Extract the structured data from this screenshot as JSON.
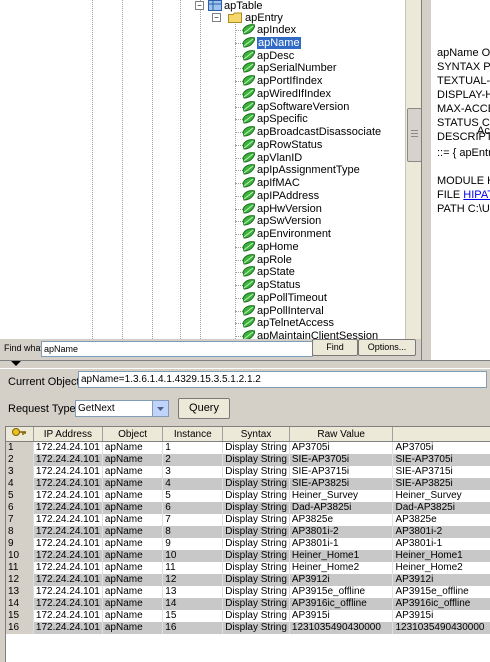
{
  "tree": {
    "table_label": "apTable",
    "entry_label": "apEntry",
    "items": [
      "apIndex",
      "apName",
      "apDesc",
      "apSerialNumber",
      "apPortIfIndex",
      "apWiredIfIndex",
      "apSoftwareVersion",
      "apSpecific",
      "apBroadcastDisassociate",
      "apRowStatus",
      "apVlanID",
      "apIpAssignmentType",
      "apIfMAC",
      "apIPAddress",
      "apHwVersion",
      "apSwVersion",
      "apEnvironment",
      "apHome",
      "apRole",
      "apState",
      "apStatus",
      "apPollTimeout",
      "apPollInterval",
      "apTelnetAccess",
      "apMaintainClientSession"
    ],
    "selected": "apName"
  },
  "right_pane": {
    "lines": [
      "apName OB",
      "SYNTAX Pri",
      "TEXTUAL-C",
      "DISPLAY-H",
      "MAX-ACCES",
      "STATUS Cu",
      "DESCRIPT",
      "",
      "Ac",
      "",
      "::= { apEntry",
      "",
      "MODULE H",
      "FILE HIPAT",
      "PATH C:\\Us"
    ],
    "link_text": "HIPAT"
  },
  "find": {
    "label": "Find what:",
    "value": "apName",
    "find_button": "Find",
    "options_button": "Options..."
  },
  "form": {
    "current_object_label": "Current Object:",
    "current_object_value": "apName=1.3.6.1.4.1.4329.15.3.5.1.2.1.2",
    "request_type_label": "Request Type:",
    "request_type_value": "GetNext",
    "query_button": "Query"
  },
  "table": {
    "columns": [
      "",
      "IP Address",
      "Object",
      "Instance",
      "Syntax",
      "Raw Value",
      ""
    ],
    "rows": [
      [
        "1",
        "172.24.24.101",
        "apName",
        "1",
        "Display String",
        "AP3705i",
        "AP3705i"
      ],
      [
        "2",
        "172.24.24.101",
        "apName",
        "2",
        "Display String",
        "SIE-AP3705i",
        "SIE-AP3705i"
      ],
      [
        "3",
        "172.24.24.101",
        "apName",
        "3",
        "Display String",
        "SIE-AP3715i",
        "SIE-AP3715i"
      ],
      [
        "4",
        "172.24.24.101",
        "apName",
        "4",
        "Display String",
        "SIE-AP3825i",
        "SIE-AP3825i"
      ],
      [
        "5",
        "172.24.24.101",
        "apName",
        "5",
        "Display String",
        "Heiner_Survey",
        "Heiner_Survey"
      ],
      [
        "6",
        "172.24.24.101",
        "apName",
        "6",
        "Display String",
        "Dad-AP3825i",
        "Dad-AP3825i"
      ],
      [
        "7",
        "172.24.24.101",
        "apName",
        "7",
        "Display String",
        "AP3825e",
        "AP3825e"
      ],
      [
        "8",
        "172.24.24.101",
        "apName",
        "8",
        "Display String",
        "AP3801i-2",
        "AP3801i-2"
      ],
      [
        "9",
        "172.24.24.101",
        "apName",
        "9",
        "Display String",
        "AP3801i-1",
        "AP3801i-1"
      ],
      [
        "10",
        "172.24.24.101",
        "apName",
        "10",
        "Display String",
        "Heiner_Home1",
        "Heiner_Home1"
      ],
      [
        "11",
        "172.24.24.101",
        "apName",
        "11",
        "Display String",
        "Heiner_Home2",
        "Heiner_Home2"
      ],
      [
        "12",
        "172.24.24.101",
        "apName",
        "12",
        "Display String",
        "AP3912i",
        "AP3912i"
      ],
      [
        "13",
        "172.24.24.101",
        "apName",
        "13",
        "Display String",
        "AP3915e_offline",
        "AP3915e_offline"
      ],
      [
        "14",
        "172.24.24.101",
        "apName",
        "14",
        "Display String",
        "AP3916ic_offline",
        "AP3916ic_offline"
      ],
      [
        "15",
        "172.24.24.101",
        "apName",
        "15",
        "Display String",
        "AP3915i",
        "AP3915i"
      ],
      [
        "16",
        "172.24.24.101",
        "apName",
        "16",
        "Display String",
        "1231035490430000",
        "1231035490430000"
      ]
    ]
  }
}
